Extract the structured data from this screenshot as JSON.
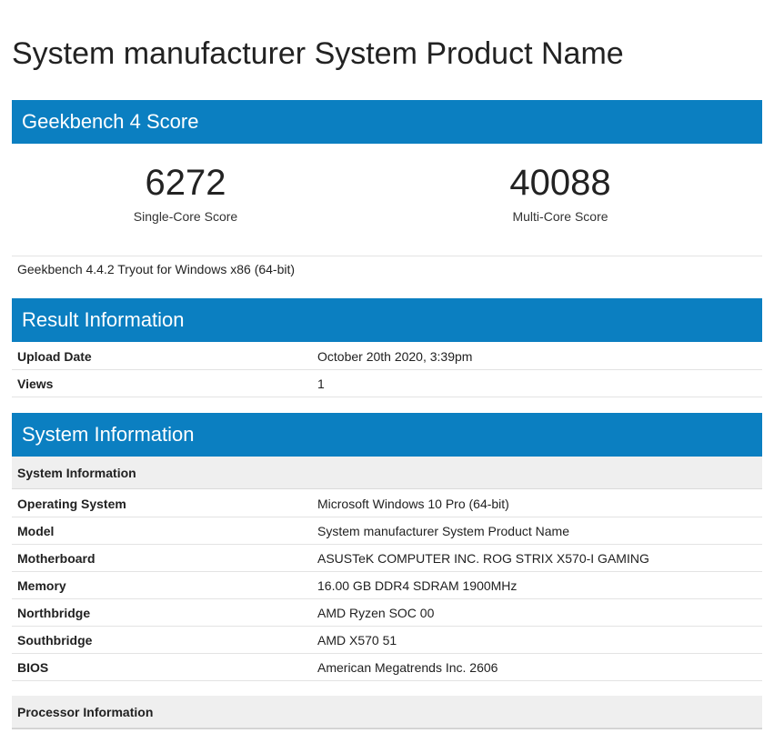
{
  "page_title": "System manufacturer System Product Name",
  "geekbench": {
    "header": "Geekbench 4 Score",
    "single_core": {
      "value": "6272",
      "label": "Single-Core Score"
    },
    "multi_core": {
      "value": "40088",
      "label": "Multi-Core Score"
    },
    "version": "Geekbench 4.4.2 Tryout for Windows x86 (64-bit)"
  },
  "result_info": {
    "header": "Result Information",
    "rows": [
      {
        "key": "Upload Date",
        "value": "October 20th 2020, 3:39pm"
      },
      {
        "key": "Views",
        "value": "1"
      }
    ]
  },
  "system_info": {
    "header": "System Information",
    "subheader": "System Information",
    "rows": [
      {
        "key": "Operating System",
        "value": "Microsoft Windows 10 Pro (64-bit)"
      },
      {
        "key": "Model",
        "value": "System manufacturer System Product Name"
      },
      {
        "key": "Motherboard",
        "value": "ASUSTeK COMPUTER INC. ROG STRIX X570-I GAMING"
      },
      {
        "key": "Memory",
        "value": "16.00 GB DDR4 SDRAM 1900MHz"
      },
      {
        "key": "Northbridge",
        "value": "AMD Ryzen SOC 00"
      },
      {
        "key": "Southbridge",
        "value": "AMD X570 51"
      },
      {
        "key": "BIOS",
        "value": "American Megatrends Inc. 2606"
      }
    ],
    "processor_subheader": "Processor Information"
  },
  "colors": {
    "section_header_bg": "#0b7fc1",
    "subheader_bg": "#efefef",
    "row_border": "#e3e3e3"
  }
}
